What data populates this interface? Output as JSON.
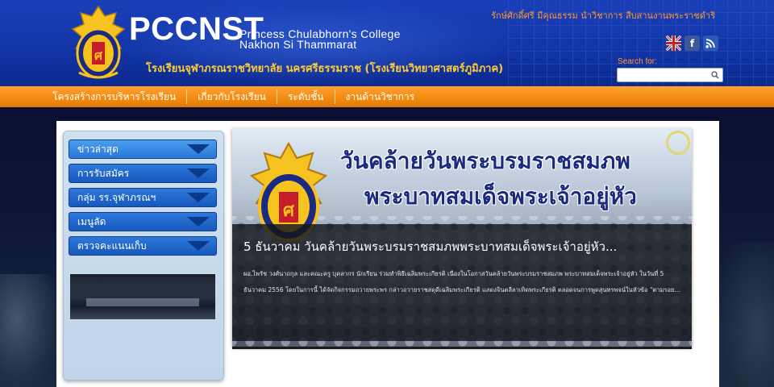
{
  "header": {
    "brand_title": "PCCNST",
    "brand_sub_line1": "Princess Chulabhorn's College",
    "brand_sub_line2": "Nakhon Si Thammarat",
    "brand_thai": "โรงเรียนจุฬาภรณราชวิทยาลัย นครศรีธรรมราช (โรงเรียนวิทยาศาสตร์ภูมิภาค)",
    "motto": "รักษ์ศักดิ์ศรี มีคุณธรรม นำวิชาการ สืบสานงานพระราชดำริ",
    "social": {
      "english_icon": "uk-flag-icon",
      "facebook_icon": "facebook-icon",
      "facebook_glyph": "f",
      "rss_icon": "rss-icon"
    },
    "search": {
      "label": "Search for:",
      "placeholder": "",
      "button_icon": "search-icon"
    }
  },
  "nav": {
    "items": [
      "โครงสร้างการบริหารโรงเรียน",
      "เกี่ยวกับโรงเรียน",
      "ระดับชั้น",
      "งานด้านวิชาการ"
    ]
  },
  "sidebar": {
    "items": [
      {
        "label": "ข่าวล่าสุด",
        "active": true
      },
      {
        "label": "การรับสมัคร",
        "active": false
      },
      {
        "label": "กลุ่ม รร.จุฬาภรณฯ",
        "active": false
      },
      {
        "label": "เมนูลัด",
        "active": false
      },
      {
        "label": "ตรวจคะแนนเก็บ",
        "active": false
      }
    ]
  },
  "feature": {
    "headline_line1": "วันคล้ายวันพระบรมราชสมภพ",
    "headline_line2": "พระบาทสมเด็จพระเจ้าอยู่หัว",
    "caption_title": "5 ธันวาคม วันคล้ายวันพระบรมราชสมภพพระบาทสมเด็จพระเจ้าอยู่หัว...",
    "caption_body": "ผอ.ไพรัช วงศ์นาถกุล และคณะครู บุคลากร นักเรียน ร่วมทำพิธีเฉลิมพระเกียรติ เนื่องในโอกาสวันคล้ายวันพระบรมราชสมภพ พระบาทสมเด็จพระเจ้าอยู่หัว ในวันที่ 5 ธันวาคม 2556 โดยในการนี้ ได้จัดกิจกรรมถวายพระพร กล่าวถวายราชสดุดีเฉลิมพระเกียรติ แสดงจินตลีลาเทิดพระเกียรติ ตลอดจนการพูดสุนทรพจน์ในหัวข้อ \"ตามรอย..."
  },
  "colors": {
    "header_blue": "#1a3fb8",
    "nav_orange": "#f28a10",
    "accent_gold": "#ffcc33",
    "side_blue": "#1858bc"
  }
}
